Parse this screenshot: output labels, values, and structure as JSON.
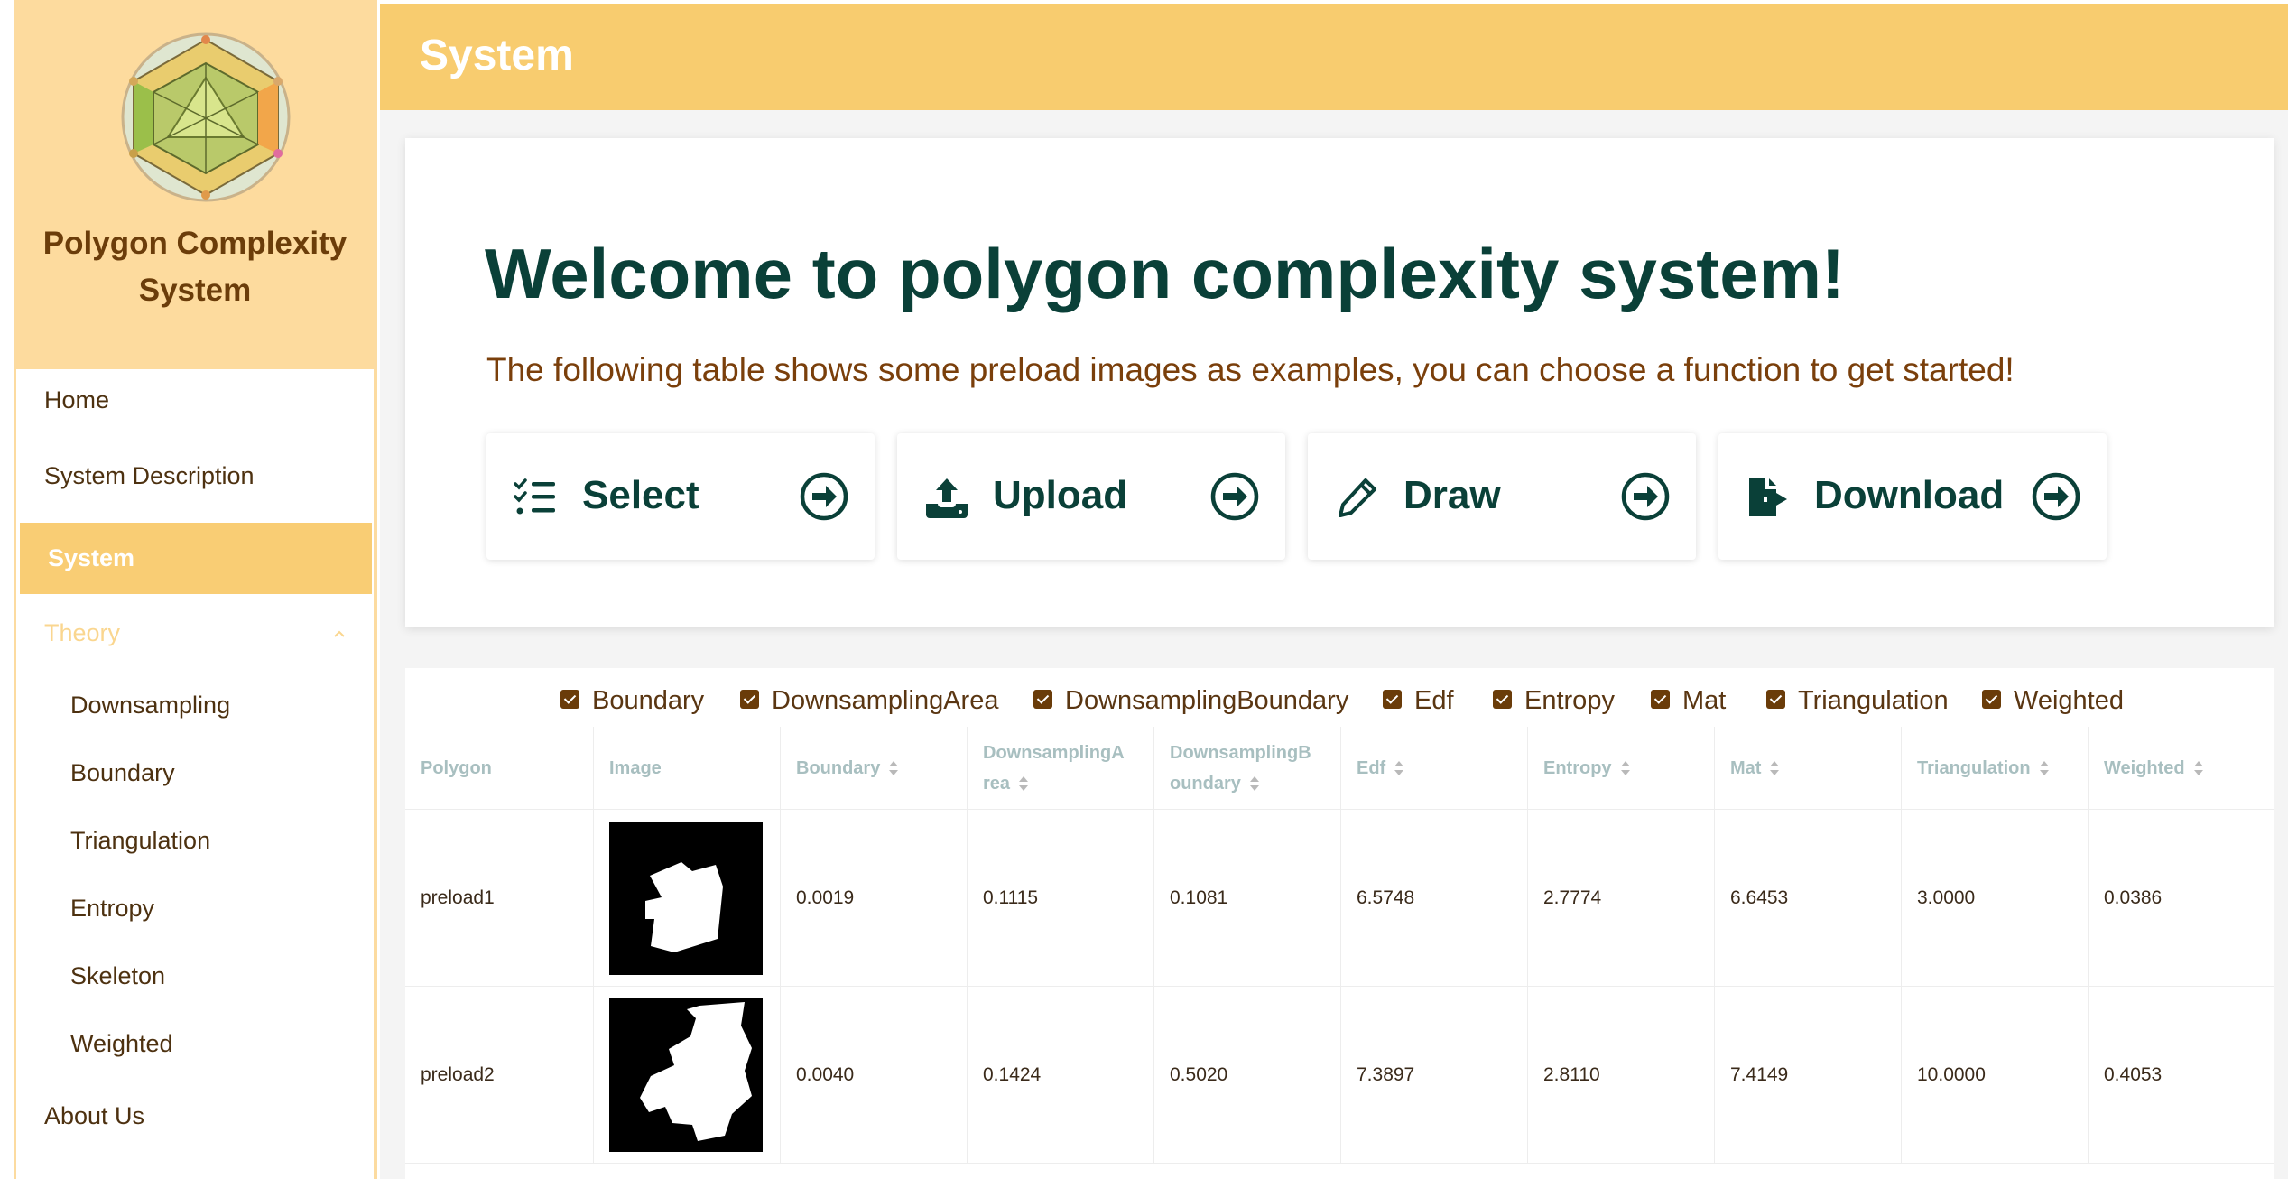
{
  "app": {
    "name": "Polygon Complexity System"
  },
  "sidebar": {
    "items": [
      {
        "label": "Home"
      },
      {
        "label": "System Description"
      },
      {
        "label": "System",
        "active": true
      },
      {
        "label": "Theory",
        "expanded": true
      },
      {
        "label": "Downsampling"
      },
      {
        "label": "Boundary"
      },
      {
        "label": "Triangulation"
      },
      {
        "label": "Entropy"
      },
      {
        "label": "Skeleton"
      },
      {
        "label": "Weighted"
      },
      {
        "label": "About Us"
      }
    ]
  },
  "header": {
    "title": "System"
  },
  "hero": {
    "title": "Welcome to polygon complexity system!",
    "subtitle": "The following table shows some preload images as examples, you can choose a function to get started!",
    "actions": [
      {
        "label": "Select",
        "icon": "list-check-icon"
      },
      {
        "label": "Upload",
        "icon": "upload-icon"
      },
      {
        "label": "Draw",
        "icon": "pencil-icon"
      },
      {
        "label": "Download",
        "icon": "file-export-icon"
      }
    ]
  },
  "filters": [
    {
      "label": "Boundary",
      "checked": true
    },
    {
      "label": "DownsamplingArea",
      "checked": true
    },
    {
      "label": "DownsamplingBoundary",
      "checked": true
    },
    {
      "label": "Edf",
      "checked": true
    },
    {
      "label": "Entropy",
      "checked": true
    },
    {
      "label": "Mat",
      "checked": true
    },
    {
      "label": "Triangulation",
      "checked": true
    },
    {
      "label": "Weighted",
      "checked": true
    }
  ],
  "table": {
    "columns": [
      "Polygon",
      "Image",
      "Boundary",
      "DownsamplingA\nrea",
      "DownsamplingB\noundary",
      "Edf",
      "Entropy",
      "Mat",
      "Triangulation",
      "Weighted"
    ],
    "rows": [
      {
        "polygon": "preload1",
        "boundary": "0.0019",
        "downsampling_area": "0.1115",
        "downsampling_boundary": "0.1081",
        "edf": "6.5748",
        "entropy": "2.7774",
        "mat": "6.6453",
        "triangulation": "3.0000",
        "weighted": "0.0386"
      },
      {
        "polygon": "preload2",
        "boundary": "0.0040",
        "downsampling_area": "0.1424",
        "downsampling_boundary": "0.5020",
        "edf": "7.3897",
        "entropy": "2.8110",
        "mat": "7.4149",
        "triangulation": "10.0000",
        "weighted": "0.4053"
      }
    ]
  },
  "colors": {
    "accent": "#f8cc6f",
    "sidebar_header": "#fddb9e",
    "title_green": "#0a4038",
    "brown_text": "#7a3f0b"
  }
}
